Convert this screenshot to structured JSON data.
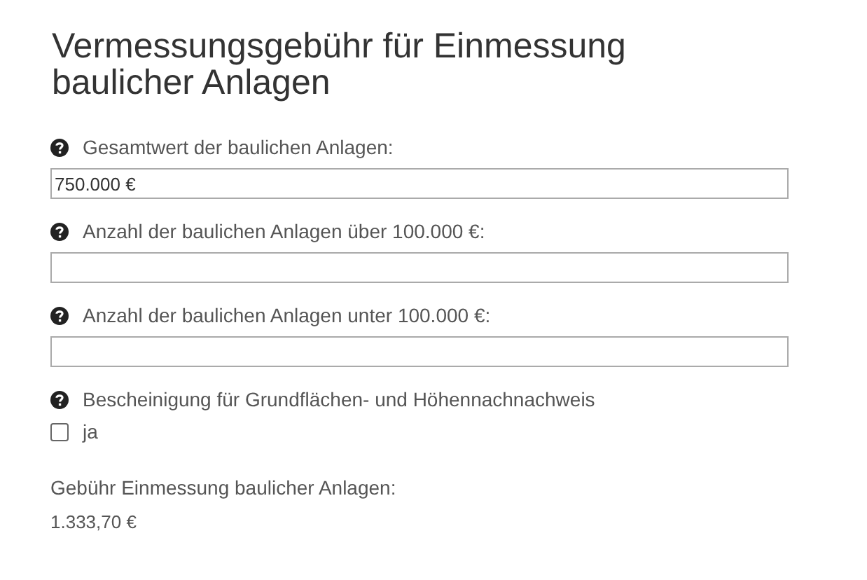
{
  "title": "Vermessungsgebühr für Einmessung baulicher Anlagen",
  "fields": [
    {
      "kind": "text",
      "label": "Gesamtwert der baulichen Anlagen:",
      "value": "750.000 €"
    },
    {
      "kind": "text",
      "label": "Anzahl der baulichen Anlagen über 100.000 €:"
    },
    {
      "kind": "text",
      "label": "Anzahl der baulichen Anlagen unter 100.000 €:"
    },
    {
      "kind": "checkbox",
      "label": "Bescheinigung für Grundflächen- und Höhennachnachweis",
      "option": "ja",
      "checked": false
    }
  ],
  "result": {
    "label": "Gebühr Einmessung baulicher Anlagen:",
    "value": "1.333,70 €"
  }
}
